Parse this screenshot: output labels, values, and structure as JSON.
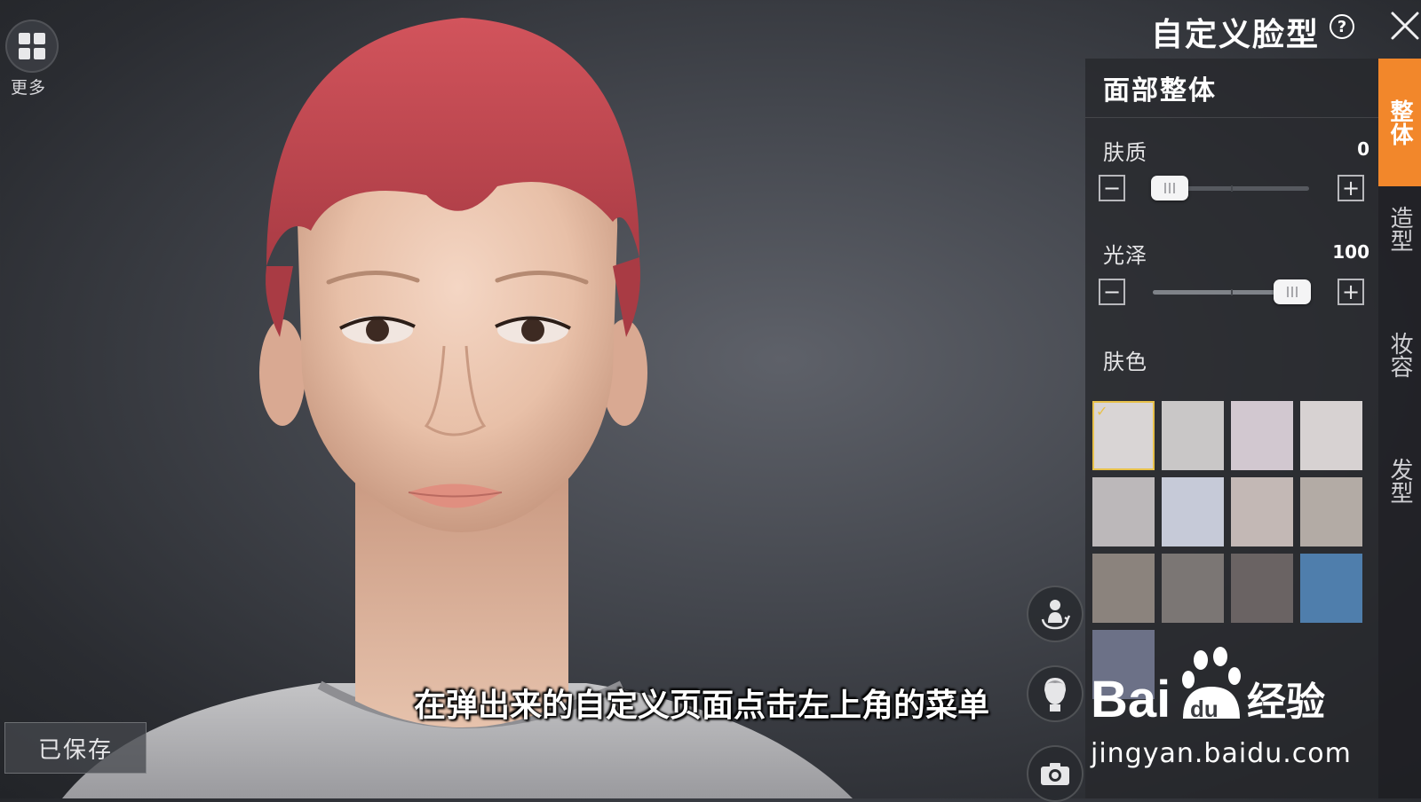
{
  "header": {
    "title": "自定义脸型",
    "help_icon": "?"
  },
  "more": {
    "label": "更多"
  },
  "saved_button": {
    "label": "已保存"
  },
  "subtitle": "在弹出来的自定义页面点击左上角的菜单",
  "panel": {
    "section_title": "面部整体",
    "params": [
      {
        "label": "肤质",
        "value": "0",
        "level": 0
      },
      {
        "label": "光泽",
        "value": "100",
        "level": 1
      }
    ],
    "color_label": "肤色",
    "swatches": [
      {
        "color": "#d9d5d5",
        "selected": true
      },
      {
        "color": "#c9c7c7"
      },
      {
        "color": "#d2c8d0"
      },
      {
        "color": "#d7d2d2"
      },
      {
        "color": "#bcb8ba"
      },
      {
        "color": "#c6cad8"
      },
      {
        "color": "#c3b8b5"
      },
      {
        "color": "#b3aba5"
      },
      {
        "color": "#8b837d"
      },
      {
        "color": "#7b7674"
      },
      {
        "color": "#6a6363"
      },
      {
        "color": "#4f7eac"
      },
      {
        "color": "#6c7187"
      }
    ]
  },
  "tabs": [
    "整体",
    "造型",
    "妆容",
    "发型"
  ],
  "watermark": {
    "logo": "Bai du 经验",
    "url": "jingyan.baidu.com"
  },
  "icons": {
    "more": "grid-icon",
    "help": "help-icon",
    "close": "close-icon",
    "minus": "minus-icon",
    "plus": "plus-icon",
    "view_body": "body-rotate-icon",
    "view_head": "head-icon",
    "camera": "camera-icon"
  },
  "colors": {
    "accent": "#f2872b",
    "selected": "#e8c14a"
  }
}
